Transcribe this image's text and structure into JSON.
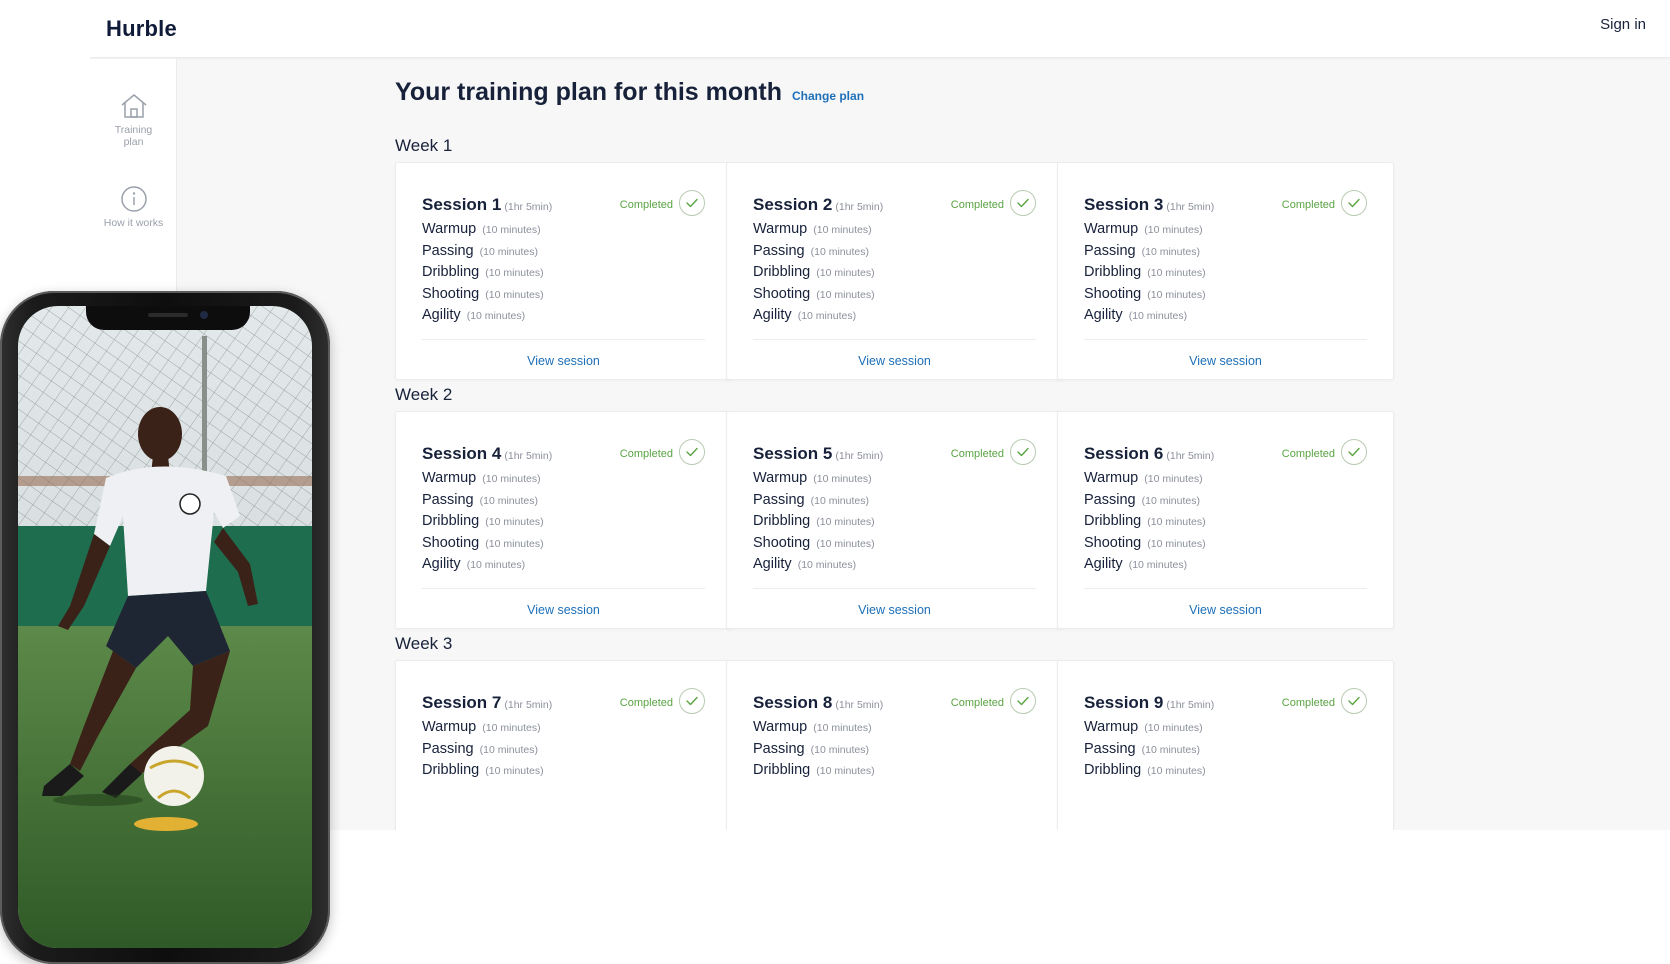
{
  "app": {
    "brand": "Hurble",
    "sign_in": "Sign in"
  },
  "sidebar": {
    "items": [
      {
        "label": "Training plan",
        "icon": "home-icon"
      },
      {
        "label": "How it works",
        "icon": "info-icon"
      }
    ]
  },
  "page": {
    "title": "Your training plan for this month",
    "change_plan": "Change plan"
  },
  "colors": {
    "accent_blue": "#1d6fb8",
    "completed_green": "#5aa443",
    "text_dark": "#17213a",
    "muted": "#8b909b"
  },
  "weeks": [
    {
      "label": "Week 1",
      "sessions": [
        {
          "name": "Session 1",
          "duration": "(1hr 5min)",
          "status": "Completed",
          "drills": [
            {
              "name": "Warmup",
              "duration": "(10 minutes)"
            },
            {
              "name": "Passing",
              "duration": "(10 minutes)"
            },
            {
              "name": "Dribbling",
              "duration": "(10 minutes)"
            },
            {
              "name": "Shooting",
              "duration": "(10 minutes)"
            },
            {
              "name": "Agility",
              "duration": "(10 minutes)"
            }
          ],
          "link": "View session"
        },
        {
          "name": "Session 2",
          "duration": "(1hr 5min)",
          "status": "Completed",
          "drills": [
            {
              "name": "Warmup",
              "duration": "(10 minutes)"
            },
            {
              "name": "Passing",
              "duration": "(10 minutes)"
            },
            {
              "name": "Dribbling",
              "duration": "(10 minutes)"
            },
            {
              "name": "Shooting",
              "duration": "(10 minutes)"
            },
            {
              "name": "Agility",
              "duration": "(10 minutes)"
            }
          ],
          "link": "View session"
        },
        {
          "name": "Session 3",
          "duration": "(1hr 5min)",
          "status": "Completed",
          "drills": [
            {
              "name": "Warmup",
              "duration": "(10 minutes)"
            },
            {
              "name": "Passing",
              "duration": "(10 minutes)"
            },
            {
              "name": "Dribbling",
              "duration": "(10 minutes)"
            },
            {
              "name": "Shooting",
              "duration": "(10 minutes)"
            },
            {
              "name": "Agility",
              "duration": "(10 minutes)"
            }
          ],
          "link": "View session"
        }
      ]
    },
    {
      "label": "Week 2",
      "sessions": [
        {
          "name": "Session 4",
          "duration": "(1hr 5min)",
          "status": "Completed",
          "drills": [
            {
              "name": "Warmup",
              "duration": "(10 minutes)"
            },
            {
              "name": "Passing",
              "duration": "(10 minutes)"
            },
            {
              "name": "Dribbling",
              "duration": "(10 minutes)"
            },
            {
              "name": "Shooting",
              "duration": "(10 minutes)"
            },
            {
              "name": "Agility",
              "duration": "(10 minutes)"
            }
          ],
          "link": "View session"
        },
        {
          "name": "Session 5",
          "duration": "(1hr 5min)",
          "status": "Completed",
          "drills": [
            {
              "name": "Warmup",
              "duration": "(10 minutes)"
            },
            {
              "name": "Passing",
              "duration": "(10 minutes)"
            },
            {
              "name": "Dribbling",
              "duration": "(10 minutes)"
            },
            {
              "name": "Shooting",
              "duration": "(10 minutes)"
            },
            {
              "name": "Agility",
              "duration": "(10 minutes)"
            }
          ],
          "link": "View session"
        },
        {
          "name": "Session 6",
          "duration": "(1hr 5min)",
          "status": "Completed",
          "drills": [
            {
              "name": "Warmup",
              "duration": "(10 minutes)"
            },
            {
              "name": "Passing",
              "duration": "(10 minutes)"
            },
            {
              "name": "Dribbling",
              "duration": "(10 minutes)"
            },
            {
              "name": "Shooting",
              "duration": "(10 minutes)"
            },
            {
              "name": "Agility",
              "duration": "(10 minutes)"
            }
          ],
          "link": "View session"
        }
      ]
    },
    {
      "label": "Week 3",
      "sessions": [
        {
          "name": "Session 7",
          "duration": "(1hr 5min)",
          "status": "Completed",
          "drills": [
            {
              "name": "Warmup",
              "duration": "(10 minutes)"
            },
            {
              "name": "Passing",
              "duration": "(10 minutes)"
            },
            {
              "name": "Dribbling",
              "duration": "(10 minutes)"
            }
          ]
        },
        {
          "name": "Session 8",
          "duration": "(1hr 5min)",
          "status": "Completed",
          "drills": [
            {
              "name": "Warmup",
              "duration": "(10 minutes)"
            },
            {
              "name": "Passing",
              "duration": "(10 minutes)"
            },
            {
              "name": "Dribbling",
              "duration": "(10 minutes)"
            }
          ]
        },
        {
          "name": "Session 9",
          "duration": "(1hr 5min)",
          "status": "Completed",
          "drills": [
            {
              "name": "Warmup",
              "duration": "(10 minutes)"
            },
            {
              "name": "Passing",
              "duration": "(10 minutes)"
            },
            {
              "name": "Dribbling",
              "duration": "(10 minutes)"
            }
          ]
        }
      ]
    }
  ]
}
